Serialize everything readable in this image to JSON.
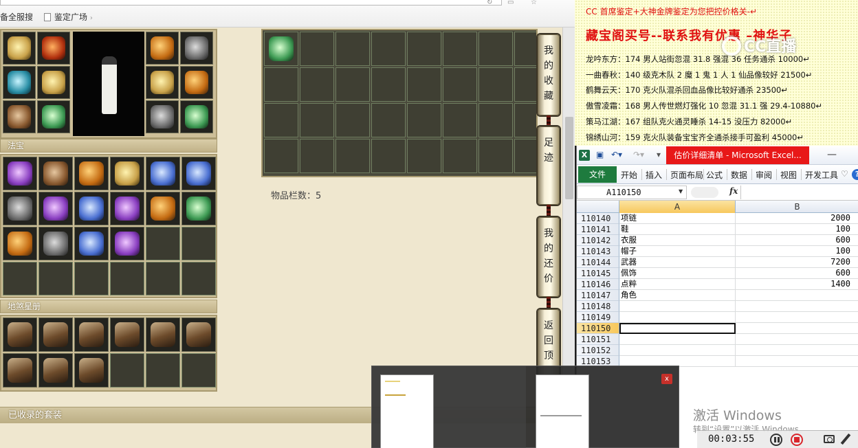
{
  "browser": {
    "bookmarks": [
      {
        "label": "备全服搜"
      },
      {
        "label": "鉴定广场"
      }
    ],
    "sections": {
      "fabao": "法宝",
      "stars": "地煞星册",
      "suits": "已收录的套装"
    },
    "item_count": "物品栏数：5",
    "side_tabs": [
      {
        "chars": [
          "我",
          "的",
          "收",
          "藏"
        ]
      },
      {
        "chars": [
          "足",
          "迹"
        ]
      },
      {
        "chars": [
          "我",
          "的",
          "还",
          "价"
        ]
      },
      {
        "chars": [
          "返",
          "回",
          "顶"
        ]
      }
    ],
    "icons": {
      "equipment": [
        "gold",
        "red",
        "orange",
        "gray",
        "teal",
        "gold",
        "gold",
        "orange",
        "brown",
        "green",
        "gray",
        "green"
      ],
      "fabao": [
        "violet",
        "brown",
        "orange",
        "gold",
        "blue",
        "blue",
        "gray",
        "violet",
        "blue",
        "violet",
        "orange",
        "green",
        "orange",
        "gray",
        "blue",
        "violet"
      ],
      "inventory_first": "green"
    }
  },
  "doc": {
    "line1": "CC 首席鉴定+大神金牌鉴定为您把控价格关-↵",
    "line2": "藏宝阁买号--联系我有优惠 –神华子",
    "entries": [
      "龙吟东方：174 男人站街忽混 31.8 强混 36 任务通杀 10000↵",
      "一曲春秋：140 级克木队 2 魔 1 鬼 1 人 1 仙品像较好 21500↵",
      "鹤舞云天：170 克火队混杀回血品像比较好通杀 23500↵",
      "傲雪凌霜：168 男人传世燃灯强化 10 忽混 31.1 强 29.4-10880↵",
      "策马江湖：167 组队克火通灵睡杀 14-15 没压力 82000↵",
      "锦绣山河：159 克火队装备宝宝齐全通杀接手可盈利 45000↵"
    ],
    "watermark": "CC直播"
  },
  "excel": {
    "app_icon": "X",
    "title": "估价详细清单 - Microsoft Excel...",
    "ribbon_tabs": [
      "文件",
      "开始",
      "插入",
      "页面布局",
      "公式",
      "数据",
      "审阅",
      "视图",
      "开发工具"
    ],
    "help": "?",
    "name_box": "A110150",
    "fx": "fx",
    "col_a": "A",
    "col_b": "B",
    "rows": [
      {
        "num": "110140",
        "a": "项链",
        "b": "2000"
      },
      {
        "num": "110141",
        "a": "鞋",
        "b": "100"
      },
      {
        "num": "110142",
        "a": "衣服",
        "b": "600"
      },
      {
        "num": "110143",
        "a": "帽子",
        "b": "100"
      },
      {
        "num": "110144",
        "a": "武器",
        "b": "7200"
      },
      {
        "num": "110145",
        "a": "佩饰",
        "b": "600"
      },
      {
        "num": "110146",
        "a": "点粹",
        "b": "1400"
      },
      {
        "num": "110147",
        "a": "角色",
        "b": ""
      },
      {
        "num": "110148",
        "a": "",
        "b": ""
      },
      {
        "num": "110149",
        "a": "",
        "b": ""
      },
      {
        "num": "110150",
        "a": "",
        "b": ""
      },
      {
        "num": "110151",
        "a": "",
        "b": ""
      },
      {
        "num": "110152",
        "a": "",
        "b": ""
      },
      {
        "num": "110153",
        "a": "",
        "b": ""
      }
    ],
    "active_row": "110150"
  },
  "taskbar": {
    "close": "x"
  },
  "system": {
    "activate_title": "激活 Windows",
    "activate_sub": "转到“设置”以激活 Windows。",
    "recorder_time": "00:03:55"
  }
}
